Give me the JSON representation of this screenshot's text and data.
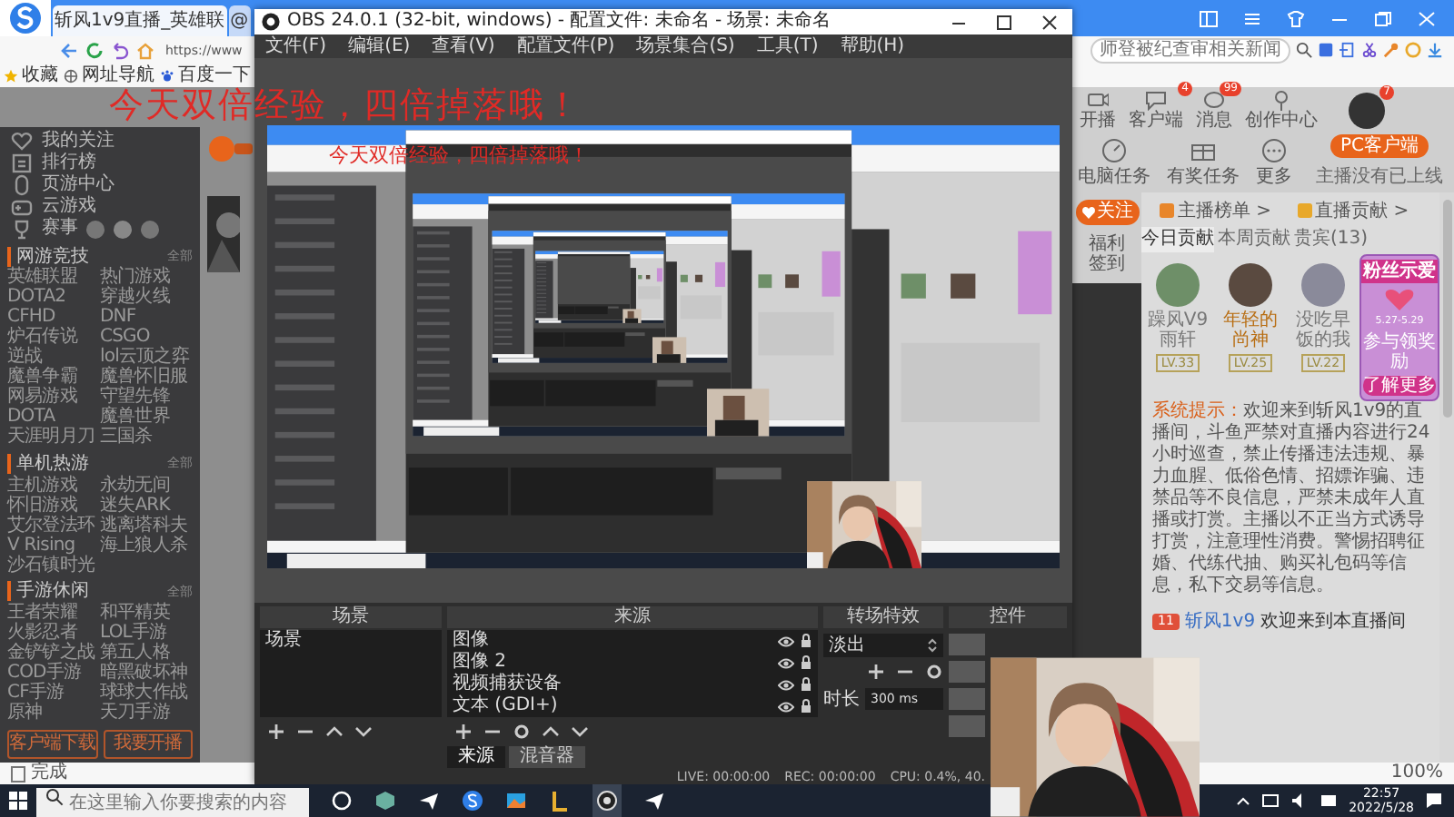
{
  "browser": {
    "tabs": [
      {
        "title": "斩风1v9直播_英雄联",
        "selected": true
      },
      {
        "title": "@",
        "selected": false
      }
    ],
    "address": "https://www",
    "search": {
      "placeholder": "师登被纪查审相关新闻"
    },
    "bookmarks": [
      "收藏",
      "网址导航",
      "百度一下"
    ],
    "sidebar": {
      "nav": [
        "我的关注",
        "排行榜",
        "页游中心",
        "云游戏",
        "赛事"
      ],
      "sections": [
        {
          "title": "网游竞技",
          "more": "全部",
          "items": [
            "英雄联盟",
            "热门游戏",
            "DOTA2",
            "穿越火线",
            "CFHD",
            "DNF",
            "炉石传说",
            "CSGO",
            "逆战",
            "lol云顶之弈",
            "魔兽争霸",
            "魔兽怀旧服",
            "网易游戏",
            "守望先锋",
            "DOTA",
            "魔兽世界",
            "天涯明月刀",
            "三国杀"
          ]
        },
        {
          "title": "单机热游",
          "more": "全部",
          "items": [
            "主机游戏",
            "永劫无间",
            "怀旧游戏",
            "迷失ARK",
            "艾尔登法环",
            "逃离塔科夫",
            "V Rising",
            "海上狼人杀",
            "沙石镇时光"
          ]
        },
        {
          "title": "手游休闲",
          "more": "全部",
          "items": [
            "王者荣耀",
            "和平精英",
            "火影忍者",
            "LOL手游",
            "金铲铲之战",
            "第五人格",
            "COD手游",
            "暗黑破坏神",
            "CF手游",
            "球球大作战",
            "原神",
            "天刀手游"
          ]
        }
      ],
      "buttons": [
        "客户端下载",
        "我要开播"
      ]
    },
    "header": {
      "items": [
        {
          "label": "开播"
        },
        {
          "label": "客户端",
          "badge": "4"
        },
        {
          "label": "消息",
          "badge": "99"
        },
        {
          "label": "创作中心"
        }
      ],
      "avatar_badge": "7"
    },
    "tasks": {
      "items": [
        "电脑任务",
        "有奖任务",
        "更多"
      ],
      "client_button": "PC客户端",
      "client_note": "主播没有已上线"
    },
    "follow_button": "关注",
    "checkin": "福利签到",
    "ranking": {
      "links": [
        "主播榜单 >",
        "直播贡献 >"
      ],
      "tabs": [
        {
          "label": "今日贡献",
          "selected": true
        },
        {
          "label": "本周贡献",
          "selected": false
        },
        {
          "label": "贵宾(13)",
          "selected": false
        }
      ],
      "fans": [
        {
          "name": "躁风V9雨轩",
          "level": "LV.33",
          "highlight": false
        },
        {
          "name": "年轻的尚神",
          "level": "LV.25",
          "highlight": true
        },
        {
          "name": "没吃早饭的我",
          "level": "LV.22",
          "highlight": false
        }
      ]
    },
    "promo": {
      "title": "粉丝示爱",
      "dates": "5.27-5.29",
      "note": "参与领奖励",
      "button": "了解更多"
    },
    "notice": {
      "label": "系统提示：",
      "text": "欢迎来到斩风1v9的直播间，斗鱼严禁对直播内容进行24小时巡查，禁止传播违法违规、暴力血腥、低俗色情、招嫖诈骗、违禁品等不良信息，严禁未成年人直播或打赏。主播以不正当方式诱导打赏，注意理性消费。警惕招聘征婚、代练代抽、购买礼包码等信息，私下交易等信息。"
    },
    "chat": [
      {
        "level": "11",
        "user": "斩风1v9",
        "text": "欢迎来到本直播间"
      }
    ],
    "status": "完成",
    "zoom": "100%"
  },
  "obs": {
    "title": "OBS 24.0.1 (32-bit, windows) - 配置文件: 未命名 - 场景: 未命名",
    "menu": [
      "文件(F)",
      "编辑(E)",
      "查看(V)",
      "配置文件(P)",
      "场景集合(S)",
      "工具(T)",
      "帮助(H)"
    ],
    "preview": {
      "overlay_text": "今天双倍经验，四倍掉落哦！"
    },
    "scenes": {
      "title": "场景",
      "items": [
        "场景"
      ]
    },
    "sources": {
      "title": "来源",
      "items": [
        "图像",
        "图像 2",
        "视频捕获设备",
        "文本 (GDI+)"
      ]
    },
    "transitions": {
      "title": "转场特效",
      "type": "淡出",
      "duration_label": "时长",
      "duration": "300 ms"
    },
    "controls": {
      "title": "控件"
    },
    "tabs": [
      {
        "label": "来源",
        "selected": true
      },
      {
        "label": "混音器",
        "selected": false
      }
    ],
    "status": [
      "LIVE: 00:00:00",
      "REC: 00:00:00",
      "CPU: 0.4%, 40."
    ]
  },
  "overlay": {
    "text": "今天双倍经验，四倍掉落哦！"
  },
  "taskbar": {
    "search": {
      "placeholder": "在这里输入你要搜索的内容"
    },
    "time": "22:57",
    "date": "2022/5/28"
  }
}
